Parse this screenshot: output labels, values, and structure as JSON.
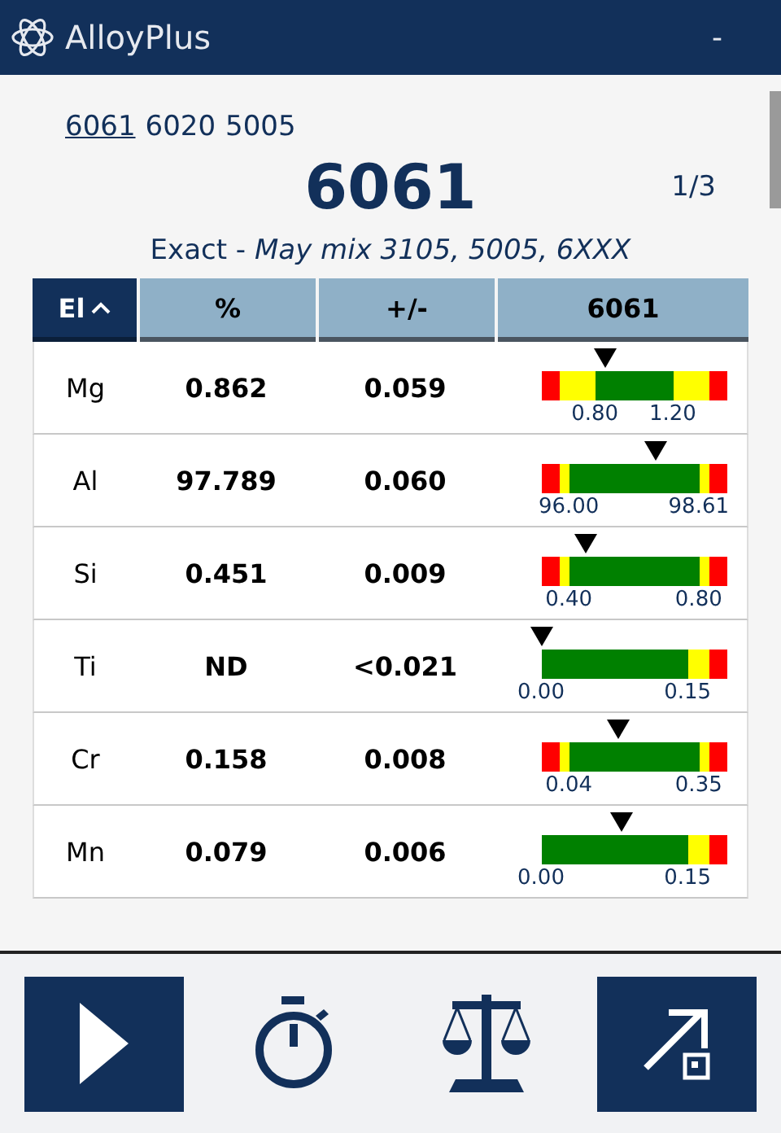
{
  "app": {
    "title": "AlloyPlus",
    "minimize": "-"
  },
  "candidates": [
    {
      "label": "6061",
      "selected": true
    },
    {
      "label": "6020",
      "selected": false
    },
    {
      "label": "5005",
      "selected": false
    }
  ],
  "result": {
    "grade": "6061",
    "page": "1/3",
    "match": "Exact - ",
    "note": "May mix 3105, 5005, 6XXX"
  },
  "table": {
    "columns": [
      "El",
      "%",
      "+/-",
      "6061"
    ],
    "rows": [
      {
        "element": "Mg",
        "percent": "0.862",
        "error": "0.059",
        "meter": {
          "kind": "wide",
          "level": 0.35,
          "low": "0.80",
          "high": "1.20"
        }
      },
      {
        "element": "Al",
        "percent": "97.789",
        "error": "0.060",
        "meter": {
          "kind": "narrow",
          "level": 0.62,
          "low": "96.00",
          "high": "98.61"
        }
      },
      {
        "element": "Si",
        "percent": "0.451",
        "error": "0.009",
        "meter": {
          "kind": "narrow",
          "level": 0.24,
          "low": "0.40",
          "high": "0.80"
        }
      },
      {
        "element": "Ti",
        "percent": "ND",
        "error": "<0.021",
        "meter": {
          "kind": "max_only",
          "level": 0.0,
          "low": "0.00",
          "high": "0.15"
        }
      },
      {
        "element": "Cr",
        "percent": "0.158",
        "error": "0.008",
        "meter": {
          "kind": "narrow",
          "level": 0.42,
          "low": "0.04",
          "high": "0.35"
        }
      },
      {
        "element": "Mn",
        "percent": "0.079",
        "error": "0.006",
        "meter": {
          "kind": "max_only",
          "level": 0.43,
          "low": "0.00",
          "high": "0.15"
        }
      }
    ]
  },
  "toolbar": [
    {
      "kind": "play",
      "filled": true
    },
    {
      "kind": "timer",
      "filled": false
    },
    {
      "kind": "scale",
      "filled": false
    },
    {
      "kind": "export",
      "filled": true
    }
  ]
}
